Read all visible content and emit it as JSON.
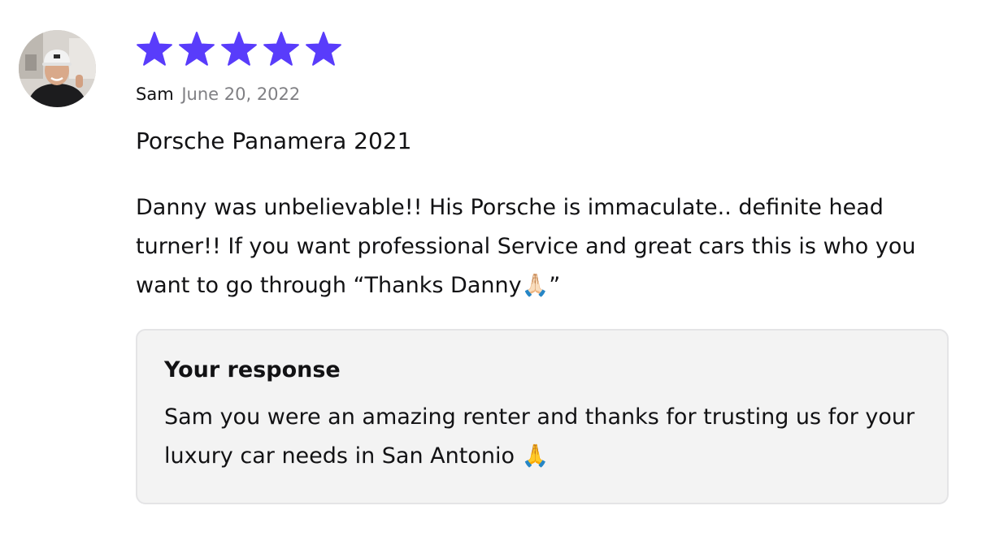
{
  "review": {
    "rating": 5,
    "max_rating": 5,
    "star_color": "#593cfb",
    "reviewer_name": "Sam",
    "date": "June 20, 2022",
    "vehicle": "Porsche Panamera 2021",
    "text": "Danny was unbelievable!! His Porsche is immaculate.. definite head turner!! If you want professional Service and great cars this is who you want to go through “Thanks Danny🙏🏻”"
  },
  "response": {
    "title": "Your response",
    "text": "Sam you were an amazing renter and thanks for trusting us for your luxury car needs in San Antonio 🙏"
  },
  "icons": {
    "star": "star-icon",
    "avatar": "reviewer-avatar"
  }
}
